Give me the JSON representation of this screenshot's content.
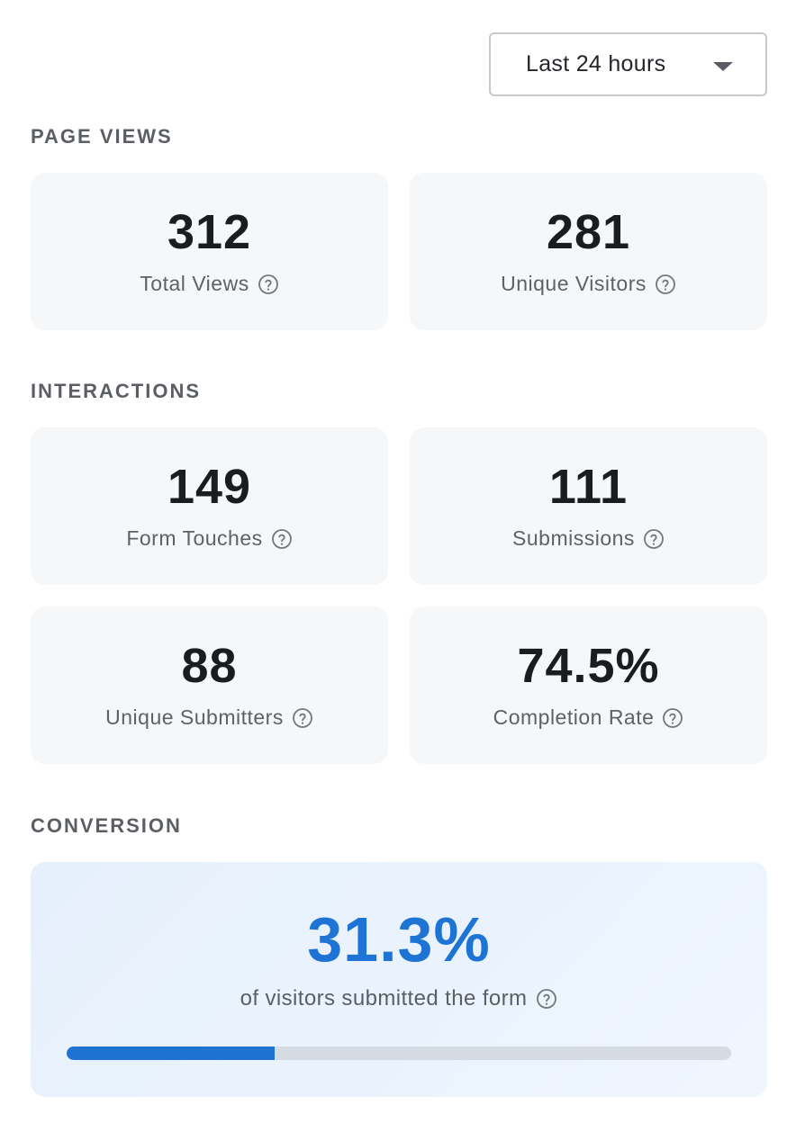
{
  "time_range": {
    "selected": "Last 24 hours"
  },
  "sections": {
    "page_views": "PAGE VIEWS",
    "interactions": "INTERACTIONS",
    "conversion": "CONVERSION"
  },
  "stats": {
    "total_views": {
      "value": "312",
      "label": "Total Views"
    },
    "unique_visitors": {
      "value": "281",
      "label": "Unique Visitors"
    },
    "form_touches": {
      "value": "149",
      "label": "Form Touches"
    },
    "submissions": {
      "value": "111",
      "label": "Submissions"
    },
    "unique_submitters": {
      "value": "88",
      "label": "Unique Submitters"
    },
    "completion_rate": {
      "value": "74.5%",
      "label": "Completion Rate"
    }
  },
  "conversion": {
    "value": "31.3%",
    "label": "of visitors submitted the form",
    "progress_fraction": 0.313
  },
  "colors": {
    "accent": "#1e74d4",
    "card_bg": "#f6f7f9",
    "track": "#d4dbe3"
  },
  "icons": {
    "help": "question-circle-icon",
    "dropdown": "caret-down-icon"
  }
}
